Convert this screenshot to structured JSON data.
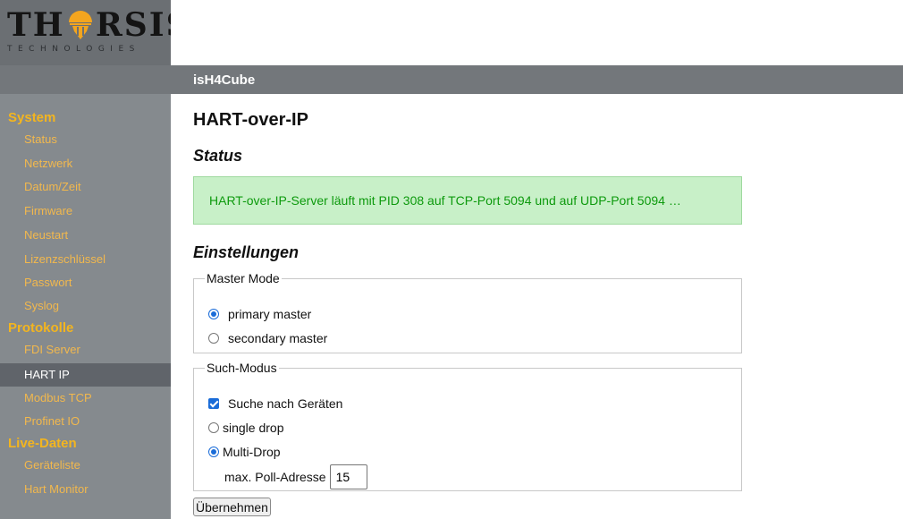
{
  "brand": {
    "name_left": "TH",
    "name_right": "RSIS",
    "tagline": "TECHNOLOGIES",
    "logo_color": "#f3a51f",
    "emblem_icon": "shield-emblem-icon"
  },
  "topbar": {
    "device_name": "isH4Cube"
  },
  "sidebar": {
    "sections": [
      {
        "title": "System",
        "items": [
          "Status",
          "Netzwerk",
          "Datum/Zeit",
          "Firmware",
          "Neustart",
          "Lizenzschlüssel",
          "Passwort",
          "Syslog"
        ]
      },
      {
        "title": "Protokolle",
        "items": [
          "FDI Server",
          "HART IP",
          "Modbus TCP",
          "Profinet IO"
        ]
      },
      {
        "title": "Live-Daten",
        "items": [
          "Geräteliste",
          "Hart Monitor"
        ]
      }
    ],
    "active_item": "HART IP"
  },
  "main": {
    "title": "HART-over-IP",
    "status_heading": "Status",
    "status_message": "HART-over-IP-Server läuft mit PID 308 auf TCP-Port 5094 und auf UDP-Port 5094 …",
    "settings_heading": "Einstellungen",
    "master_mode": {
      "legend": "Master Mode",
      "options": [
        "primary master",
        "secondary master"
      ],
      "selected": "primary master"
    },
    "search_mode": {
      "legend": "Such-Modus",
      "search_devices_label": "Suche nach Geräten",
      "search_devices_checked": true,
      "options": [
        "single drop",
        "Multi-Drop"
      ],
      "selected": "Multi-Drop",
      "poll_address_label": "max. Poll-Adresse",
      "poll_address_value": "15"
    },
    "apply_label": "Übernehmen"
  },
  "colors": {
    "sidebar_bg": "#858a8e",
    "topbar_bg": "#73777b",
    "nav_text": "#f2b84d",
    "status_bg": "#c8f0c8",
    "status_text": "#0d9a0d",
    "accent": "#1a6cd8"
  }
}
